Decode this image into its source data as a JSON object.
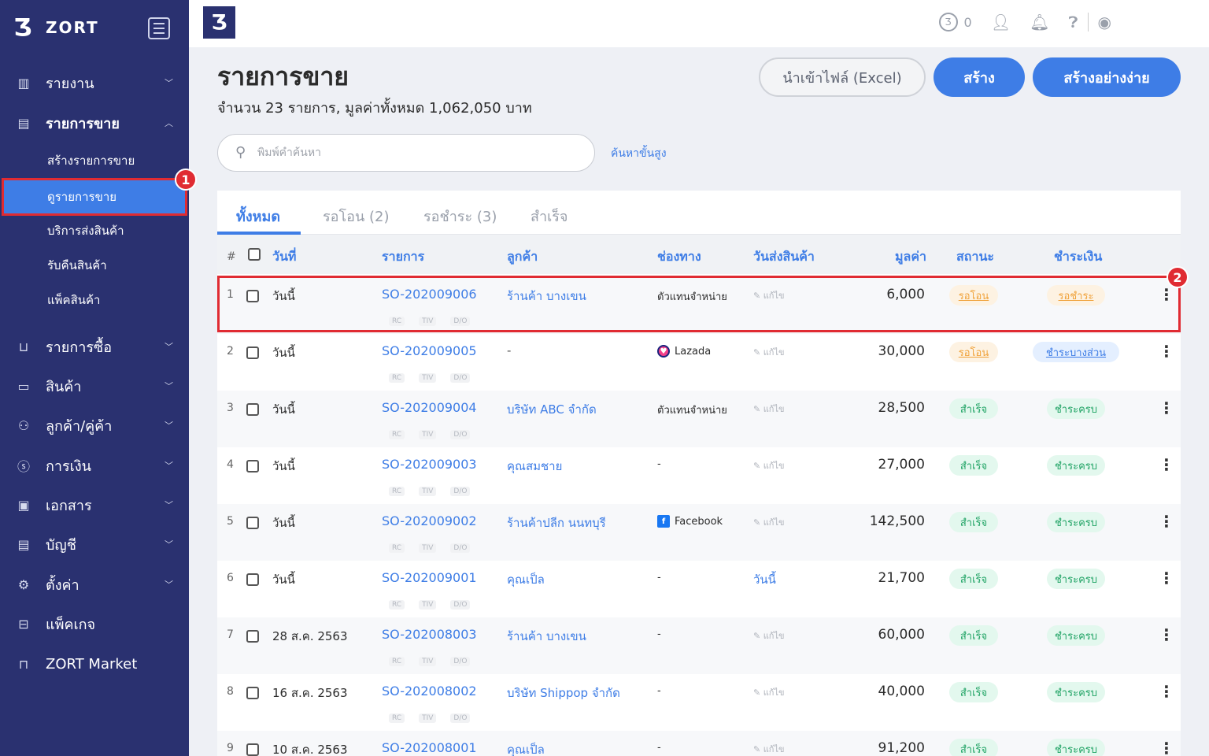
{
  "brand": {
    "name": "ZORT",
    "logo_glyph": "Ʒ"
  },
  "sidebar": {
    "menu": [
      {
        "label": "รายงาน",
        "icon": "bar-chart-icon"
      },
      {
        "label": "รายการขาย",
        "icon": "clipboard-icon"
      },
      {
        "label": "รายการซื้อ",
        "icon": "basket-icon"
      },
      {
        "label": "สินค้า",
        "icon": "box-icon"
      },
      {
        "label": "ลูกค้า/คู่ค้า",
        "icon": "users-icon"
      },
      {
        "label": "การเงิน",
        "icon": "dollar-icon"
      },
      {
        "label": "เอกสาร",
        "icon": "document-icon"
      },
      {
        "label": "บัญชี",
        "icon": "ledger-icon"
      },
      {
        "label": "ตั้งค่า",
        "icon": "gear-icon"
      },
      {
        "label": "แพ็คเกจ",
        "icon": "briefcase-icon"
      },
      {
        "label": "ZORT Market",
        "icon": "shopping-bag-icon"
      }
    ],
    "submenu": [
      {
        "label": "สร้างรายการขาย"
      },
      {
        "label": "ดูรายการขาย"
      },
      {
        "label": "บริการส่งสินค้า"
      },
      {
        "label": "รับคืนสินค้า"
      },
      {
        "label": "แพ็คสินค้า"
      }
    ],
    "annotation_1": "1"
  },
  "topbar": {
    "coin_glyph": "Ʒ",
    "coin_count": "0"
  },
  "page": {
    "title": "รายการขาย",
    "summary": "จำนวน 23 รายการ, มูลค่าทั้งหมด 1,062,050 บาท",
    "btn_import": "นำเข้าไฟล์ (Excel)",
    "btn_create": "สร้าง",
    "btn_easy": "สร้างอย่างง่าย",
    "search_placeholder": "พิมพ์คำค้นหา",
    "advanced_search": "ค้นหาขั้นสูง"
  },
  "tabs": [
    {
      "label": "ทั้งหมด"
    },
    {
      "label": "รอโอน (2)"
    },
    {
      "label": "รอชำระ (3)"
    },
    {
      "label": "สำเร็จ"
    }
  ],
  "table": {
    "headers": {
      "hash": "#",
      "date": "วันที่",
      "order": "รายการ",
      "customer": "ลูกค้า",
      "channel": "ช่องทาง",
      "ship_date": "วันส่งสินค้า",
      "value": "มูลค่า",
      "status": "สถานะ",
      "payment": "ชำระเงิน"
    },
    "tags": [
      "RC",
      "TIV",
      "D/O"
    ],
    "edit_label": "✎ แก้ไข",
    "rows": [
      {
        "num": "1",
        "date": "วันนี้",
        "order": "SO-202009006",
        "customer": "ร้านค้า บางเขน",
        "channel": "ตัวแทนจำหน่าย",
        "ship": "✎ แก้ไข",
        "value": "6,000",
        "status": "รอโอน",
        "payment": "รอชำระ"
      },
      {
        "num": "2",
        "date": "วันนี้",
        "order": "SO-202009005",
        "customer": "-",
        "channel": "Lazada",
        "ship": "✎ แก้ไข",
        "value": "30,000",
        "status": "รอโอน",
        "payment": "ชำระบางส่วน"
      },
      {
        "num": "3",
        "date": "วันนี้",
        "order": "SO-202009004",
        "customer": "บริษัท ABC จำกัด",
        "channel": "ตัวแทนจำหน่าย",
        "ship": "✎ แก้ไข",
        "value": "28,500",
        "status": "สำเร็จ",
        "payment": "ชำระครบ"
      },
      {
        "num": "4",
        "date": "วันนี้",
        "order": "SO-202009003",
        "customer": "คุณสมชาย",
        "channel": "-",
        "ship": "✎ แก้ไข",
        "value": "27,000",
        "status": "สำเร็จ",
        "payment": "ชำระครบ"
      },
      {
        "num": "5",
        "date": "วันนี้",
        "order": "SO-202009002",
        "customer": "ร้านค้าปลีก นนทบุรี",
        "channel": "Facebook",
        "ship": "✎ แก้ไข",
        "value": "142,500",
        "status": "สำเร็จ",
        "payment": "ชำระครบ"
      },
      {
        "num": "6",
        "date": "วันนี้",
        "order": "SO-202009001",
        "customer": "คุณเป็ล",
        "channel": "-",
        "ship": "วันนี้",
        "value": "21,700",
        "status": "สำเร็จ",
        "payment": "ชำระครบ"
      },
      {
        "num": "7",
        "date": "28 ส.ค. 2563",
        "order": "SO-202008003",
        "customer": "ร้านค้า บางเขน",
        "channel": "-",
        "ship": "✎ แก้ไข",
        "value": "60,000",
        "status": "สำเร็จ",
        "payment": "ชำระครบ"
      },
      {
        "num": "8",
        "date": "16 ส.ค. 2563",
        "order": "SO-202008002",
        "customer": "บริษัท Shippop จำกัด",
        "channel": "-",
        "ship": "✎ แก้ไข",
        "value": "40,000",
        "status": "สำเร็จ",
        "payment": "ชำระครบ"
      },
      {
        "num": "9",
        "date": "10 ส.ค. 2563",
        "order": "SO-202008001",
        "customer": "คุณเป็ล",
        "channel": "-",
        "ship": "✎ แก้ไข",
        "value": "91,200",
        "status": "สำเร็จ",
        "payment": "ชำระครบ"
      }
    ],
    "annotation_2": "2"
  },
  "colors": {
    "sidebar": "#2a3170",
    "accent": "#3e7de6",
    "annotation": "#e02b32",
    "success": "#22a466",
    "pending": "#f0a23a"
  }
}
